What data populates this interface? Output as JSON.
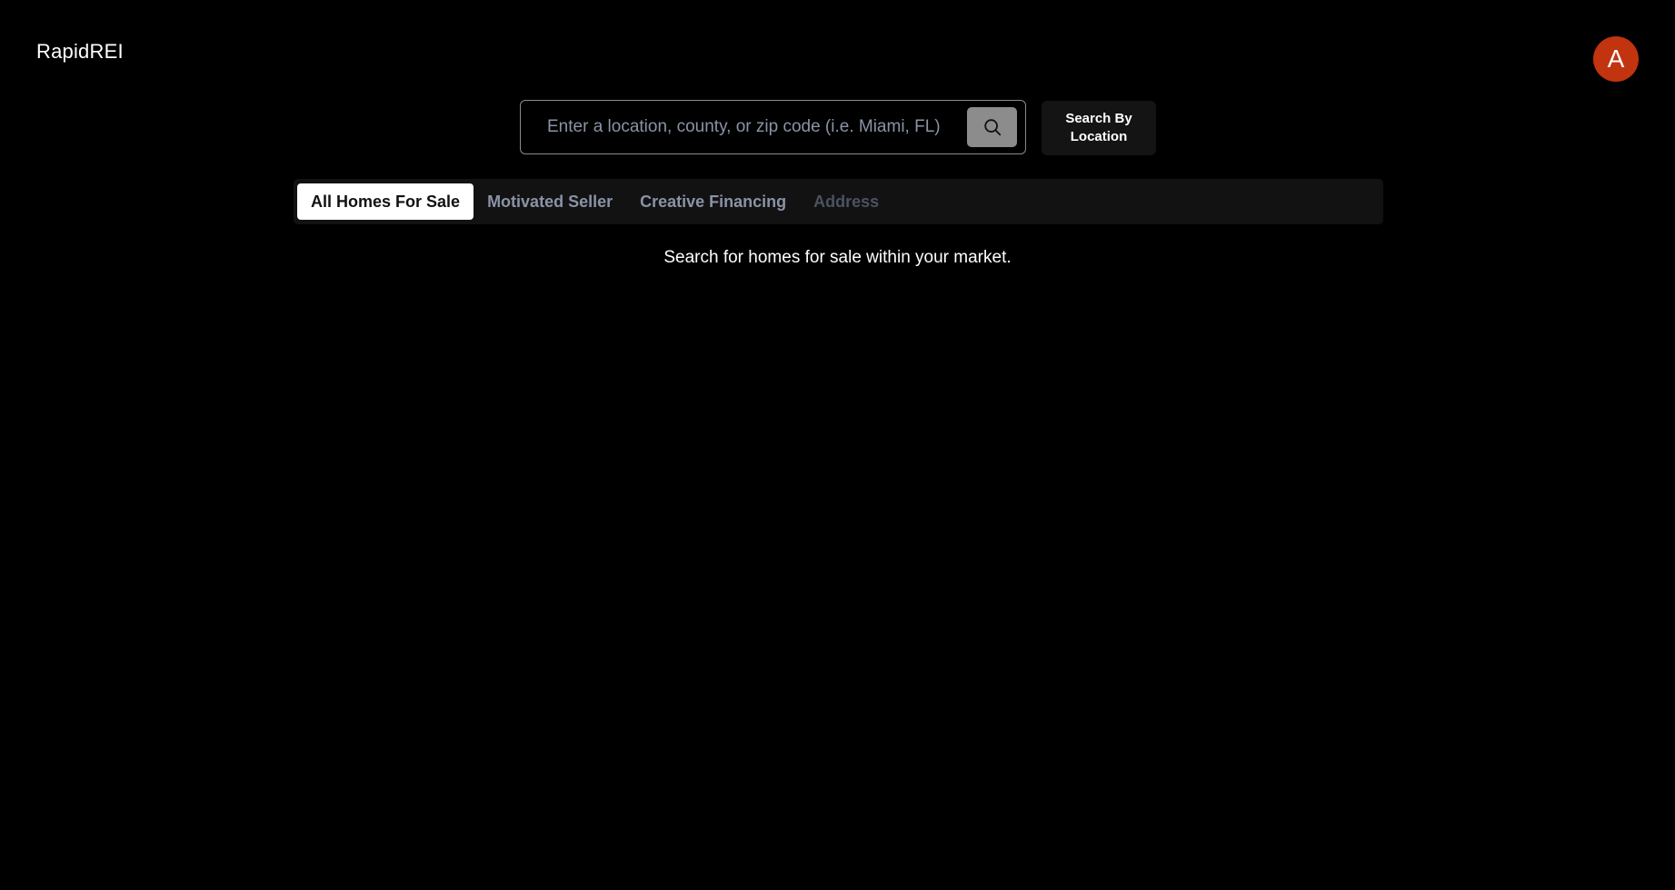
{
  "header": {
    "brand": "RapidREI",
    "avatar_initial": "A",
    "avatar_color": "#c2330f"
  },
  "search": {
    "placeholder": "Enter a location, county, or zip code (i.e. Miami, FL)",
    "value": "",
    "submit_icon": "search-icon",
    "location_button_label": "Search By Location"
  },
  "tabs": [
    {
      "label": "All Homes For Sale",
      "active": true,
      "disabled": false
    },
    {
      "label": "Motivated Seller",
      "active": false,
      "disabled": false
    },
    {
      "label": "Creative Financing",
      "active": false,
      "disabled": false
    },
    {
      "label": "Address",
      "active": false,
      "disabled": true
    }
  ],
  "main": {
    "hint": "Search for homes for sale within your market."
  }
}
